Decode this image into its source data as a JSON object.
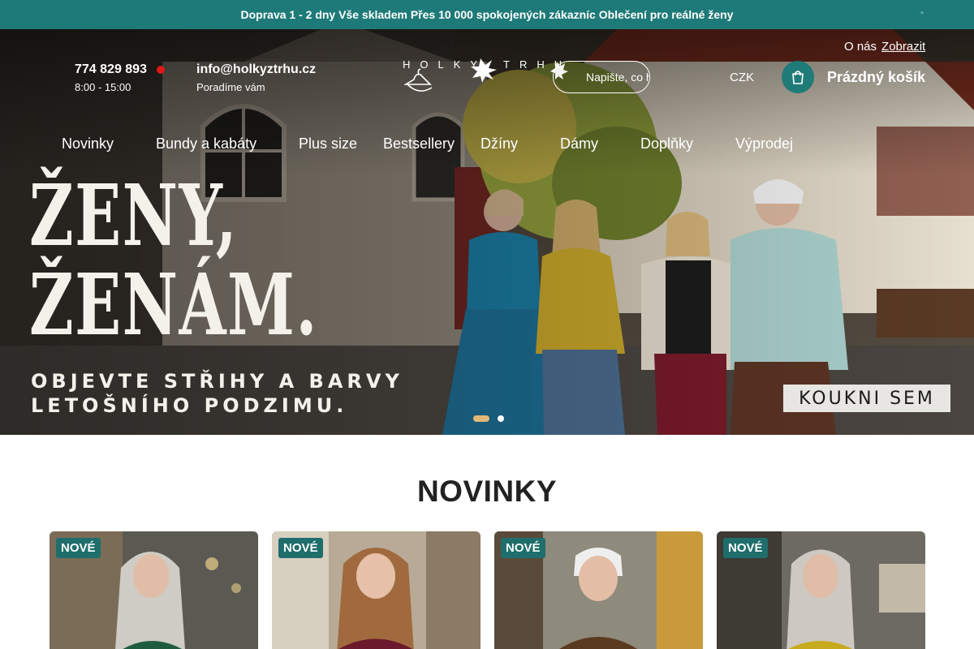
{
  "announcement": {
    "text": " Doprava 1 - 2 dny  Vše skladem  Přes 10 000 spokojených zákazníc  Oblečení pro reálné ženy",
    "close_icon": "close-icon"
  },
  "header": {
    "phone": "774 829 893",
    "hours": "8:00 - 15:00",
    "email": "info@holkyztrhu.cz",
    "email_sub": "Poradíme vám",
    "logo_text": "HOLKYZTRHU",
    "search_placeholder": "Napište, co hledáte",
    "about": "O nás",
    "about_link": "Zobrazit",
    "currency": "CZK",
    "cart_label": "Prázdný košík"
  },
  "nav": {
    "items": [
      "Novinky",
      "Bundy a kabáty",
      "Plus size",
      "Bestsellery",
      "Džíny",
      "Dámy",
      "Doplňky",
      "Výprodej"
    ]
  },
  "hero": {
    "line1": "ŽENY,",
    "line2": "ŽENÁM.",
    "sub1": "OBJEVTE STŘIHY A BARVY",
    "sub2": "LETOŠNÍHO PODZIMU.",
    "cta": "KOUKNI SEM",
    "active_slide": 1,
    "slide_count": 2
  },
  "section": {
    "title": "NOVINKY",
    "cards": [
      {
        "badge": "NOVÉ"
      },
      {
        "badge": "NOVÉ"
      },
      {
        "badge": "NOVÉ"
      },
      {
        "badge": "NOVÉ"
      }
    ]
  },
  "colors": {
    "accent": "#1e7a78",
    "badge": "#1f6e6c",
    "live_dot": "#e01818",
    "slide_dot_active": "#e0b978"
  }
}
